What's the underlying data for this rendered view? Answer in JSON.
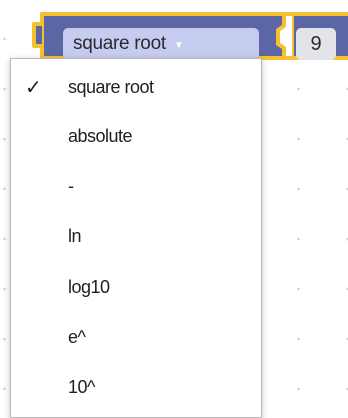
{
  "block": {
    "operation_label": "square root",
    "dropdown_arrow": "▼",
    "input_value": "9",
    "colors": {
      "block_fill": "#5b67a5",
      "field_fill": "#c6cbf0",
      "selection_outline": "#f5c12e"
    }
  },
  "menu": {
    "items": [
      {
        "label": "square root",
        "checked": "✓"
      },
      {
        "label": "absolute",
        "checked": ""
      },
      {
        "label": "-",
        "checked": ""
      },
      {
        "label": "ln",
        "checked": ""
      },
      {
        "label": "log10",
        "checked": ""
      },
      {
        "label": "e^",
        "checked": ""
      },
      {
        "label": "10^",
        "checked": ""
      }
    ]
  }
}
